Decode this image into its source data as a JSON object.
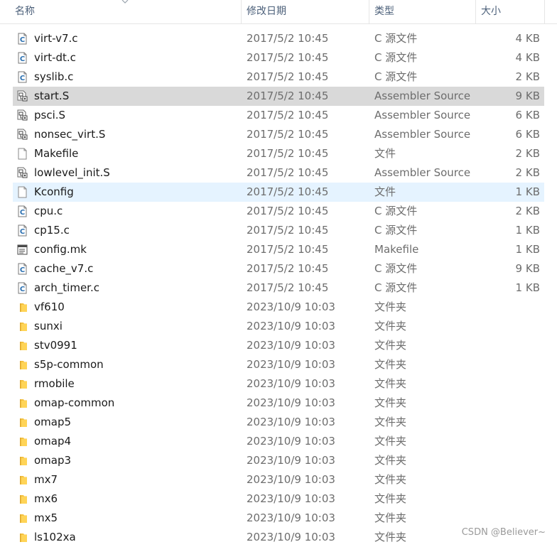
{
  "columns": {
    "name": "名称",
    "date": "修改日期",
    "type": "类型",
    "size": "大小"
  },
  "rows": [
    {
      "name": "virt-v7.c",
      "date": "2017/5/2 10:45",
      "type": "C 源文件",
      "size": "4 KB",
      "icon": "c-file-icon"
    },
    {
      "name": "virt-dt.c",
      "date": "2017/5/2 10:45",
      "type": "C 源文件",
      "size": "4 KB",
      "icon": "c-file-icon"
    },
    {
      "name": "syslib.c",
      "date": "2017/5/2 10:45",
      "type": "C 源文件",
      "size": "2 KB",
      "icon": "c-file-icon"
    },
    {
      "name": "start.S",
      "date": "2017/5/2 10:45",
      "type": "Assembler Source",
      "size": "9 KB",
      "icon": "assembler-file-icon",
      "state": "selected"
    },
    {
      "name": "psci.S",
      "date": "2017/5/2 10:45",
      "type": "Assembler Source",
      "size": "6 KB",
      "icon": "assembler-file-icon"
    },
    {
      "name": "nonsec_virt.S",
      "date": "2017/5/2 10:45",
      "type": "Assembler Source",
      "size": "6 KB",
      "icon": "assembler-file-icon"
    },
    {
      "name": "Makefile",
      "date": "2017/5/2 10:45",
      "type": "文件",
      "size": "2 KB",
      "icon": "blank-file-icon"
    },
    {
      "name": "lowlevel_init.S",
      "date": "2017/5/2 10:45",
      "type": "Assembler Source",
      "size": "2 KB",
      "icon": "assembler-file-icon"
    },
    {
      "name": "Kconfig",
      "date": "2017/5/2 10:45",
      "type": "文件",
      "size": "1 KB",
      "icon": "blank-file-icon",
      "state": "hover"
    },
    {
      "name": "cpu.c",
      "date": "2017/5/2 10:45",
      "type": "C 源文件",
      "size": "2 KB",
      "icon": "c-file-icon"
    },
    {
      "name": "cp15.c",
      "date": "2017/5/2 10:45",
      "type": "C 源文件",
      "size": "1 KB",
      "icon": "c-file-icon"
    },
    {
      "name": "config.mk",
      "date": "2017/5/2 10:45",
      "type": "Makefile",
      "size": "1 KB",
      "icon": "makefile-icon"
    },
    {
      "name": "cache_v7.c",
      "date": "2017/5/2 10:45",
      "type": "C 源文件",
      "size": "9 KB",
      "icon": "c-file-icon"
    },
    {
      "name": "arch_timer.c",
      "date": "2017/5/2 10:45",
      "type": "C 源文件",
      "size": "1 KB",
      "icon": "c-file-icon"
    },
    {
      "name": "vf610",
      "date": "2023/10/9 10:03",
      "type": "文件夹",
      "size": "",
      "icon": "folder-icon"
    },
    {
      "name": "sunxi",
      "date": "2023/10/9 10:03",
      "type": "文件夹",
      "size": "",
      "icon": "folder-icon"
    },
    {
      "name": "stv0991",
      "date": "2023/10/9 10:03",
      "type": "文件夹",
      "size": "",
      "icon": "folder-icon"
    },
    {
      "name": "s5p-common",
      "date": "2023/10/9 10:03",
      "type": "文件夹",
      "size": "",
      "icon": "folder-icon"
    },
    {
      "name": "rmobile",
      "date": "2023/10/9 10:03",
      "type": "文件夹",
      "size": "",
      "icon": "folder-icon"
    },
    {
      "name": "omap-common",
      "date": "2023/10/9 10:03",
      "type": "文件夹",
      "size": "",
      "icon": "folder-icon"
    },
    {
      "name": "omap5",
      "date": "2023/10/9 10:03",
      "type": "文件夹",
      "size": "",
      "icon": "folder-icon"
    },
    {
      "name": "omap4",
      "date": "2023/10/9 10:03",
      "type": "文件夹",
      "size": "",
      "icon": "folder-icon"
    },
    {
      "name": "omap3",
      "date": "2023/10/9 10:03",
      "type": "文件夹",
      "size": "",
      "icon": "folder-icon"
    },
    {
      "name": "mx7",
      "date": "2023/10/9 10:03",
      "type": "文件夹",
      "size": "",
      "icon": "folder-icon"
    },
    {
      "name": "mx6",
      "date": "2023/10/9 10:03",
      "type": "文件夹",
      "size": "",
      "icon": "folder-icon"
    },
    {
      "name": "mx5",
      "date": "2023/10/9 10:03",
      "type": "文件夹",
      "size": "",
      "icon": "folder-icon"
    },
    {
      "name": "ls102xa",
      "date": "2023/10/9 10:03",
      "type": "文件夹",
      "size": "",
      "icon": "folder-icon"
    }
  ],
  "watermark": "CSDN @Believer~",
  "colors": {
    "selected_row": "#d9d9d9",
    "hover_row": "#e5f3ff",
    "header_text": "#4c607a",
    "folder": "#f5c341"
  }
}
